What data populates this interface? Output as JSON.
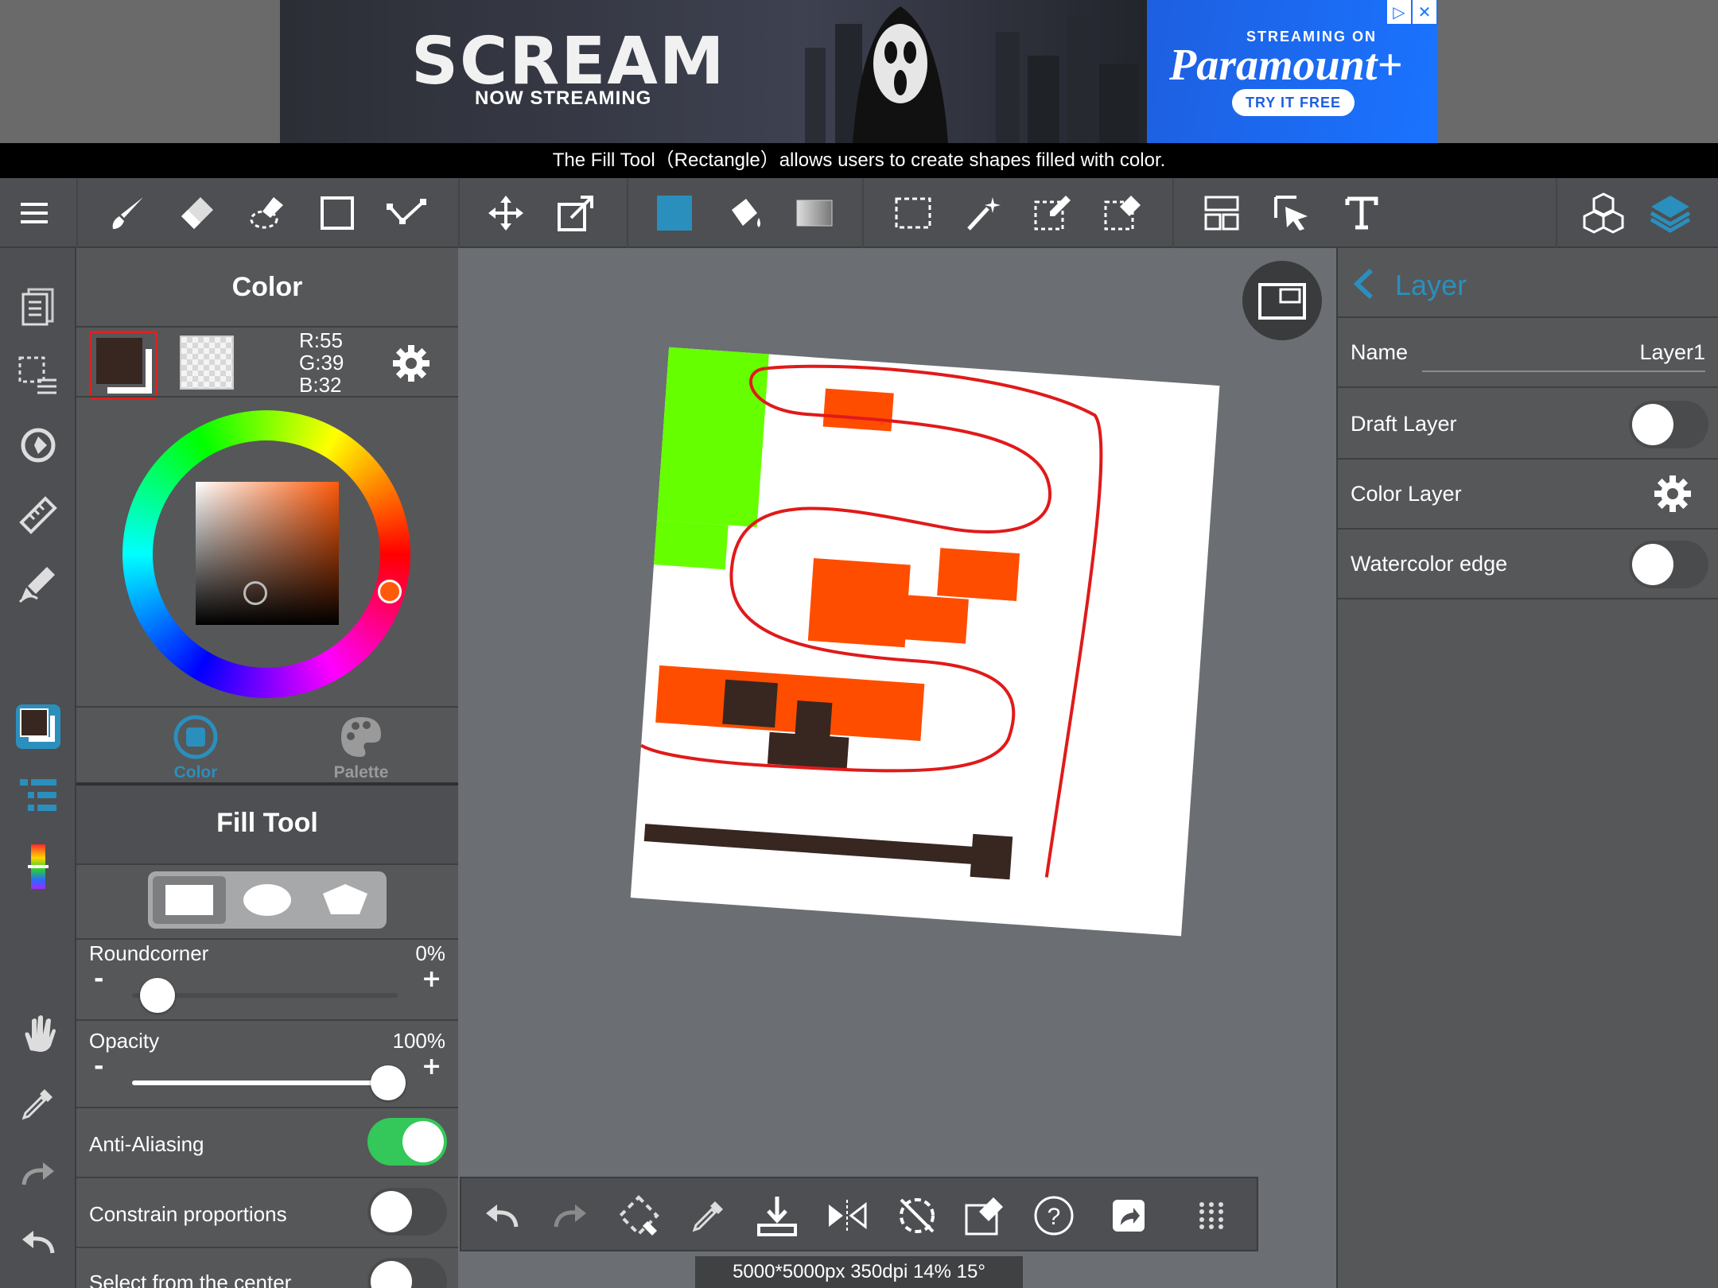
{
  "ad": {
    "headline": "SCREAM",
    "subline": "NOW STREAMING",
    "streaming_on": "STREAMING ON",
    "brand": "Paramount+",
    "cta": "TRY IT FREE",
    "adchoices_icon": "play-triangle-icon",
    "close_icon": "close-icon"
  },
  "tip": "The Fill Tool（Rectangle）allows users to create shapes filled with color.",
  "toolbar": {
    "icons": [
      "menu-icon",
      "brush-icon",
      "eraser-icon",
      "blur-eraser-icon",
      "shape-icon",
      "vector-icon",
      "move-icon",
      "transform-icon",
      "fill-color-swatch",
      "bucket-icon",
      "gradient-icon",
      "select-rect-icon",
      "magic-wand-icon",
      "select-pen-icon",
      "select-eraser-icon",
      "frame-divider-icon",
      "select-layer-icon",
      "text-icon",
      "3d-model-icon",
      "layers-icon"
    ],
    "active_color": "#2a8fbd"
  },
  "rail": {
    "icons": [
      "pages-icon",
      "selection-list-icon",
      "reference-icon",
      "ruler-icon",
      "stabilizer-icon",
      "color-swatch-icon",
      "layer-list-icon",
      "color-bar-icon",
      "hand-icon",
      "eyedropper-icon",
      "redo-icon",
      "undo-icon"
    ]
  },
  "color_panel": {
    "title": "Color",
    "rgb": {
      "r": "R:55",
      "g": "G:39",
      "b": "B:32"
    },
    "primary_color": "#372720",
    "hue_color": "#ff5a0a",
    "tabs": [
      {
        "label": "Color",
        "icon": "color-circle-icon",
        "active": true
      },
      {
        "label": "Palette",
        "icon": "palette-icon",
        "active": false
      }
    ]
  },
  "fill_tool": {
    "title": "Fill Tool",
    "shapes": [
      "rectangle-shape-icon",
      "ellipse-shape-icon",
      "polygon-shape-icon"
    ],
    "selected_shape": "rectangle",
    "roundcorner": {
      "label": "Roundcorner",
      "value": "0%",
      "level": 0
    },
    "opacity": {
      "label": "Opacity",
      "value": "100%",
      "level": 1.0
    },
    "minus": "-",
    "plus": "+",
    "anti_aliasing": {
      "label": "Anti-Aliasing",
      "on": true
    },
    "constrain": {
      "label": "Constrain proportions",
      "on": false
    },
    "select_center": {
      "label": "Select from the center",
      "on": false
    }
  },
  "layer_panel": {
    "back_label": "Layer",
    "name_label": "Name",
    "name_value": "Layer1",
    "draft_label": "Draft Layer",
    "draft_on": false,
    "color_layer_label": "Color Layer",
    "watercolor_label": "Watercolor edge",
    "watercolor_on": false
  },
  "bottom_bar": {
    "icons": [
      "undo-icon",
      "redo-icon",
      "transform-icon",
      "eyedropper-icon",
      "save-icon",
      "flip-icon",
      "rotate-reset-icon",
      "edit-select-icon",
      "help-icon",
      "share-icon",
      "grid-menu-icon"
    ]
  },
  "status": "5000*5000px 350dpi 14% 15°",
  "canvas": {
    "orange": "#ff4d00",
    "green": "#66ff00",
    "dark": "#372720",
    "red": "#e01a1a"
  }
}
